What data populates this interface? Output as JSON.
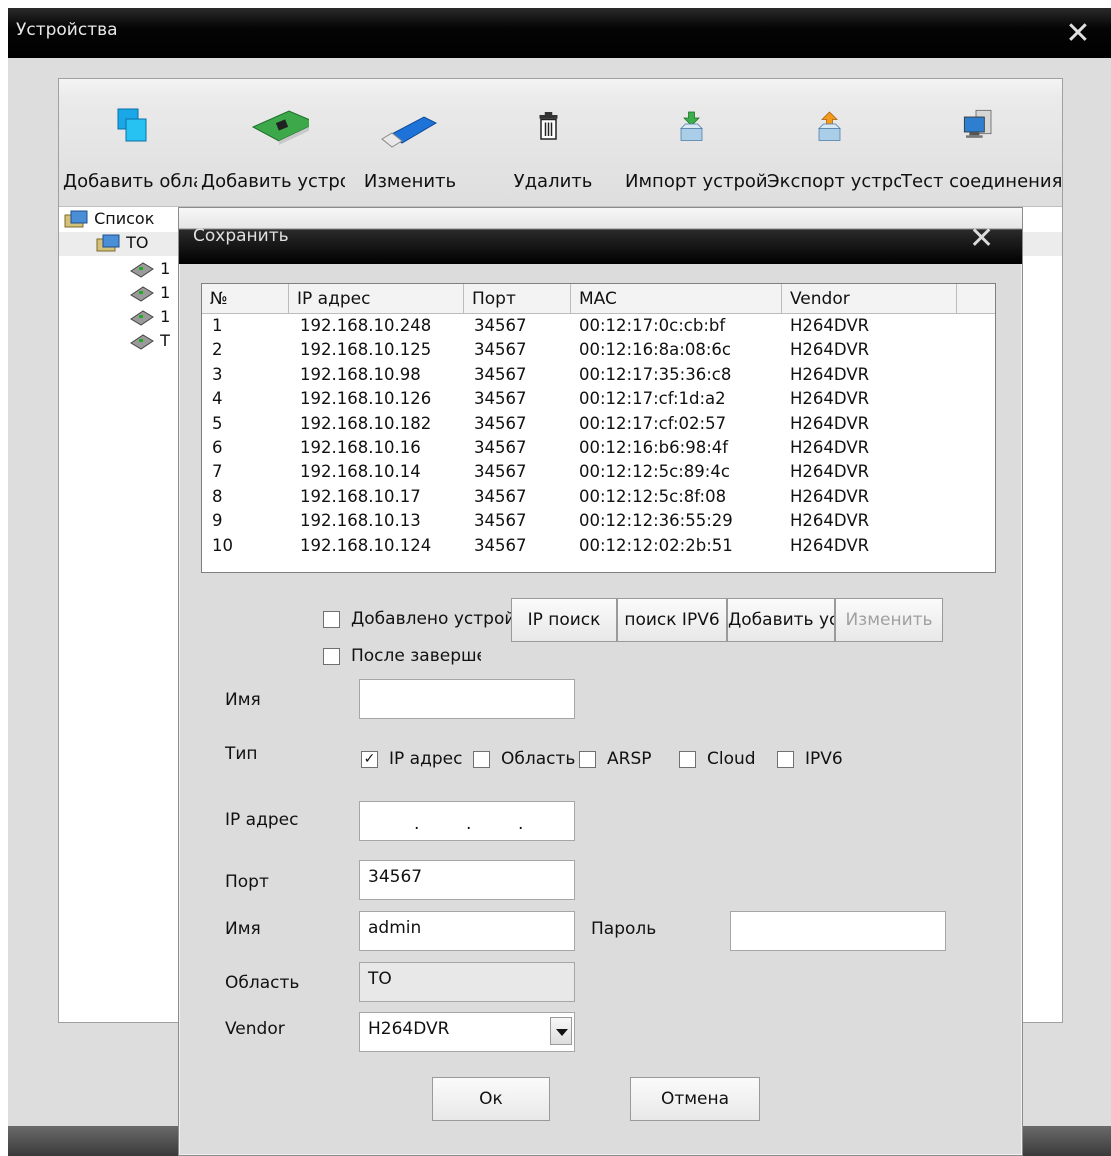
{
  "outer_window": {
    "title": "Устройства",
    "close_symbol": "✕"
  },
  "toolbar": {
    "items": [
      {
        "label": "Добавить область",
        "icon": "add-area-icon"
      },
      {
        "label": "Добавить устройство",
        "icon": "network-card-icon"
      },
      {
        "label": "Изменить",
        "icon": "usb-stick-icon"
      },
      {
        "label": "Удалить",
        "icon": "trash-icon"
      },
      {
        "label": "Импорт устройств",
        "icon": "import-icon"
      },
      {
        "label": "Экспорт устройств",
        "icon": "export-icon"
      },
      {
        "label": "Тест соединения",
        "icon": "connection-test-icon"
      }
    ]
  },
  "tree": {
    "root": "Список",
    "area": "TO",
    "devices": [
      "1",
      "1",
      "1",
      "T"
    ]
  },
  "dialog": {
    "title": "Сохранить",
    "close_symbol": "✕",
    "list": {
      "columns": [
        "№",
        "IP адрес",
        "Порт",
        "MAC",
        "Vendor"
      ],
      "rows": [
        [
          "1",
          "192.168.10.248",
          "34567",
          "00:12:17:0c:cb:bf",
          "H264DVR"
        ],
        [
          "2",
          "192.168.10.125",
          "34567",
          "00:12:16:8a:08:6c",
          "H264DVR"
        ],
        [
          "3",
          "192.168.10.98",
          "34567",
          "00:12:17:35:36:c8",
          "H264DVR"
        ],
        [
          "4",
          "192.168.10.126",
          "34567",
          "00:12:17:cf:1d:a2",
          "H264DVR"
        ],
        [
          "5",
          "192.168.10.182",
          "34567",
          "00:12:17:cf:02:57",
          "H264DVR"
        ],
        [
          "6",
          "192.168.10.16",
          "34567",
          "00:12:16:b6:98:4f",
          "H264DVR"
        ],
        [
          "7",
          "192.168.10.14",
          "34567",
          "00:12:12:5c:89:4c",
          "H264DVR"
        ],
        [
          "8",
          "192.168.10.17",
          "34567",
          "00:12:12:5c:8f:08",
          "H264DVR"
        ],
        [
          "9",
          "192.168.10.13",
          "34567",
          "00:12:12:36:55:29",
          "H264DVR"
        ],
        [
          "10",
          "192.168.10.124",
          "34567",
          "00:12:12:02:2b:51",
          "H264DVR"
        ]
      ]
    },
    "options": {
      "added_label": "Добавлено устройство",
      "after_label": "После завершения"
    },
    "buttons": {
      "ip_search": "IP поиск",
      "ipv6_search": "поиск IPV6",
      "add_device": "Добавить устройство",
      "edit": "Изменить",
      "ok": "Ок",
      "cancel": "Отмена"
    },
    "form": {
      "name_label": "Имя",
      "name_value": "",
      "type_label": "Тип",
      "type_options": [
        {
          "label": "IP адрес",
          "checked": true
        },
        {
          "label": "Область",
          "checked": false
        },
        {
          "label": "ARSP",
          "checked": false
        },
        {
          "label": "Cloud",
          "checked": false
        },
        {
          "label": "IPV6",
          "checked": false
        }
      ],
      "ip_label": "IP адрес",
      "port_label": "Порт",
      "port_value": "34567",
      "user_label": "Имя",
      "user_value": "admin",
      "password_label": "Пароль",
      "password_value": "",
      "area_label": "Область",
      "area_value": "TO",
      "vendor_label": "Vendor",
      "vendor_value": "H264DVR"
    },
    "check_mark": "✓"
  },
  "colors": {
    "titlebar": "#000000",
    "dialog_bg": "#dcdcdc",
    "panel_bg": "#ffffff",
    "toolbar_bg": "#e6e6e6"
  }
}
